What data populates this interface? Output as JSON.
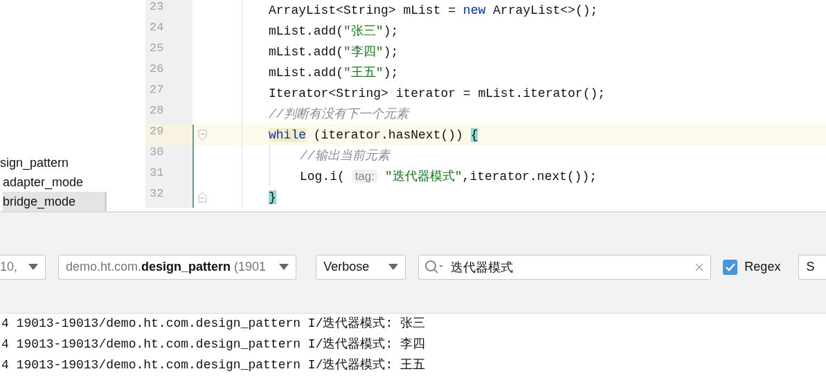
{
  "project_tree": {
    "items": [
      {
        "label": "sign_pattern",
        "selected": false,
        "children": [
          {
            "label": "adapter_mode",
            "selected": false
          },
          {
            "label": "bridge_mode",
            "selected": true
          }
        ]
      }
    ]
  },
  "editor": {
    "lines": [
      {
        "number": "23",
        "current": false,
        "indented": false,
        "kind": "line",
        "segments": [
          {
            "kind": "text",
            "text": "ArrayList<String> mList = "
          },
          {
            "kind": "keyword",
            "text": "new"
          },
          {
            "kind": "text",
            "text": " ArrayList<>();"
          }
        ]
      },
      {
        "number": "24",
        "current": false,
        "indented": false,
        "kind": "line",
        "segments": [
          {
            "kind": "text",
            "text": "mList.add("
          },
          {
            "kind": "string",
            "text": "\"张三\""
          },
          {
            "kind": "text",
            "text": ");"
          }
        ]
      },
      {
        "number": "25",
        "current": false,
        "indented": false,
        "kind": "line",
        "segments": [
          {
            "kind": "text",
            "text": "mList.add("
          },
          {
            "kind": "string",
            "text": "\"李四\""
          },
          {
            "kind": "text",
            "text": ");"
          }
        ]
      },
      {
        "number": "26",
        "current": false,
        "indented": false,
        "kind": "line",
        "segments": [
          {
            "kind": "text",
            "text": "mList.add("
          },
          {
            "kind": "string",
            "text": "\"王五\""
          },
          {
            "kind": "text",
            "text": ");"
          }
        ]
      },
      {
        "number": "27",
        "current": false,
        "indented": false,
        "kind": "line",
        "segments": [
          {
            "kind": "text",
            "text": "Iterator<String> iterator = mList.iterator();"
          }
        ]
      },
      {
        "number": "28",
        "current": false,
        "indented": false,
        "kind": "line",
        "segments": [
          {
            "kind": "comment",
            "text": "//判断有没有下一个元素"
          }
        ]
      },
      {
        "number": "29",
        "current": true,
        "indented": false,
        "kind": "block-start",
        "segments": [
          {
            "kind": "keyword-match",
            "text": "while"
          },
          {
            "kind": "text",
            "text": " (iterator.hasNext()) "
          },
          {
            "kind": "brace-match",
            "text": "{"
          }
        ]
      },
      {
        "number": "30",
        "current": false,
        "indented": true,
        "kind": "line",
        "segments": [
          {
            "kind": "comment",
            "text": "//输出当前元素"
          }
        ]
      },
      {
        "number": "31",
        "current": false,
        "indented": true,
        "kind": "line",
        "segments": [
          {
            "kind": "text",
            "text": "Log.i( "
          },
          {
            "kind": "hint",
            "text": "tag:"
          },
          {
            "kind": "string",
            "text": "\"迭代器模式\""
          },
          {
            "kind": "text",
            "text": ",iterator.next());"
          }
        ]
      },
      {
        "number": "32",
        "current": false,
        "indented": false,
        "kind": "block-end",
        "segments": [
          {
            "kind": "brace-match",
            "text": "}"
          }
        ]
      }
    ]
  },
  "toolbar": {
    "device": "10,",
    "process": "demo.ht.com.**design_pattern** (1901",
    "log_level": "Verbose",
    "search": {
      "value": "迭代器模式"
    },
    "regex": {
      "label": "Regex",
      "checked": true
    },
    "filter": "S"
  },
  "log": {
    "lines": [
      "4 19013-19013/demo.ht.com.design_pattern I/迭代器模式: 张三",
      "4 19013-19013/demo.ht.com.design_pattern I/迭代器模式: 李四",
      "4 19013-19013/demo.ht.com.design_pattern I/迭代器模式: 王五"
    ]
  }
}
